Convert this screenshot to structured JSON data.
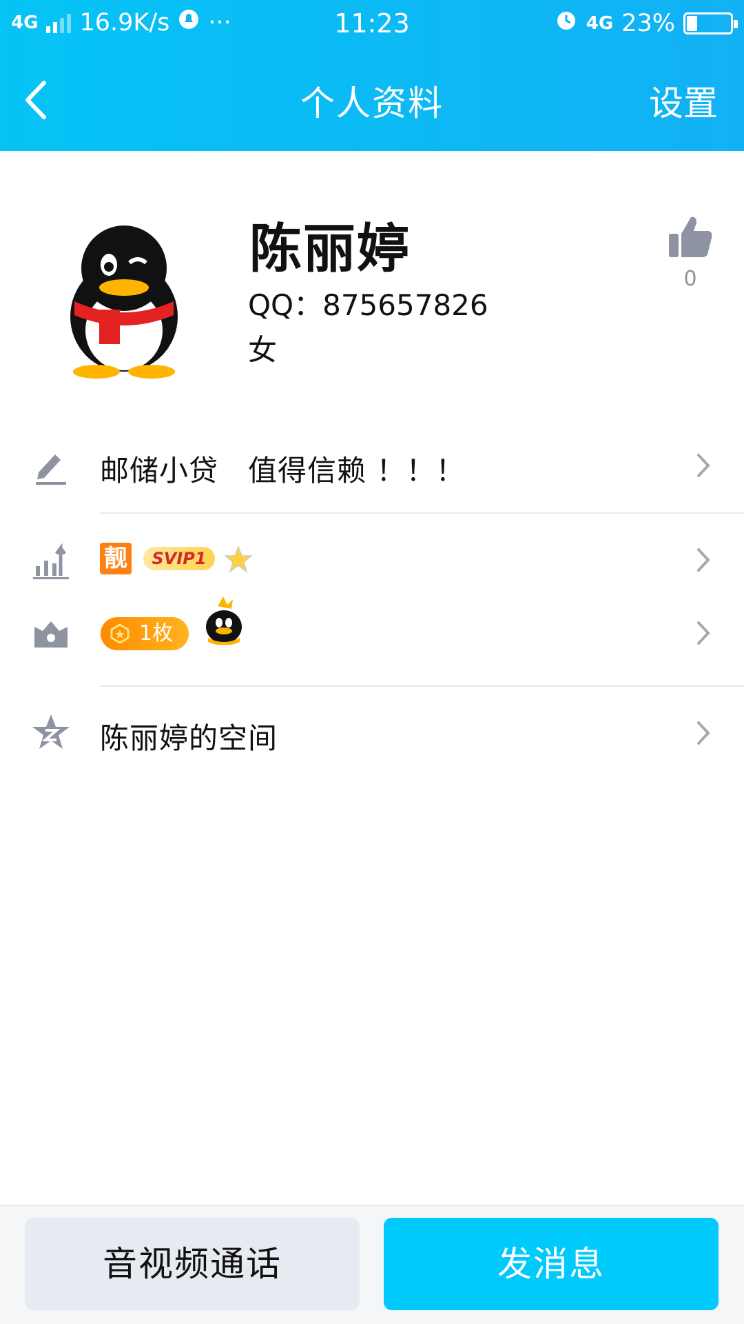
{
  "status_bar": {
    "network_left": "4G",
    "speed": "16.9K/s",
    "more": "···",
    "time": "11:23",
    "network_right": "4G",
    "battery_percent": "23%",
    "battery_level": 0.23
  },
  "nav": {
    "title": "个人资料",
    "settings_label": "设置"
  },
  "profile": {
    "name": "陈丽婷",
    "qq_label": "QQ：875657826",
    "gender": "女",
    "like_count": "0"
  },
  "rows": {
    "signature": "邮储小贷　值得信赖 ！！！",
    "level_badges": {
      "liang": "靓",
      "svip": "SVIP1"
    },
    "coin_label": "1枚",
    "space": "陈丽婷的空间"
  },
  "bottom_bar": {
    "call_label": "音视频通话",
    "message_label": "发消息"
  },
  "colors": {
    "header_start": "#05c3f5",
    "header_end": "#12b1f4",
    "primary_button": "#00cafc",
    "secondary_button": "#e7ebf1",
    "icon_gray": "#8e93a1"
  }
}
